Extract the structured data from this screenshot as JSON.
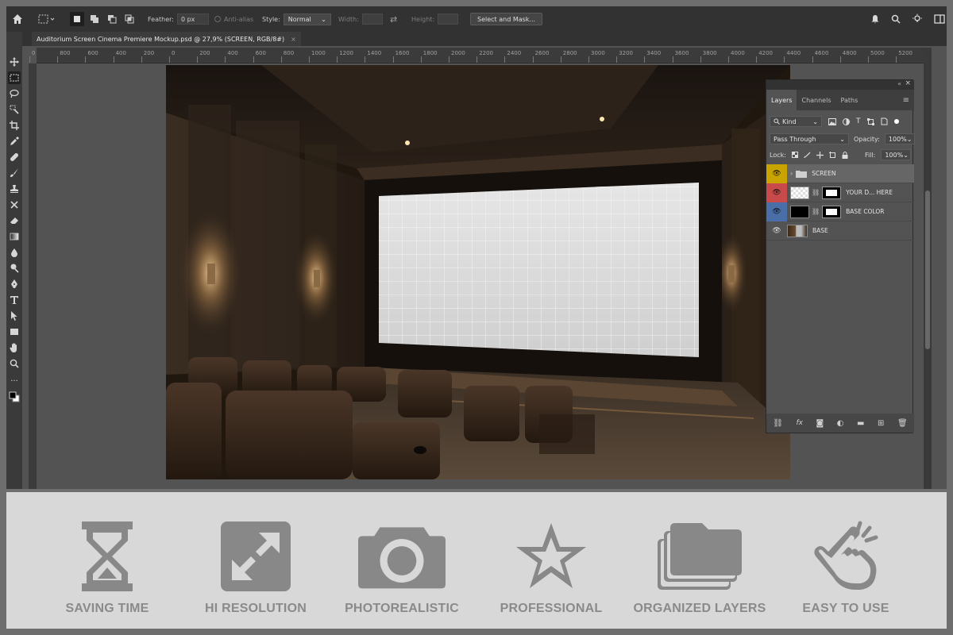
{
  "options_bar": {
    "feather_label": "Feather:",
    "feather_value": "0 px",
    "antialias_label": "Anti-alias",
    "style_label": "Style:",
    "style_value": "Normal",
    "width_label": "Width:",
    "height_label": "Height:",
    "select_mask_label": "Select and Mask..."
  },
  "document": {
    "tab_title": "Auditorium Screen Cinema Premiere Mockup.psd @ 27,9% (SCREEN, RGB/8#)",
    "close_glyph": "×"
  },
  "ruler": {
    "top_ticks": [
      "0",
      "800",
      "600",
      "400",
      "200",
      "0",
      "200",
      "400",
      "600",
      "800",
      "1000",
      "1200",
      "1400",
      "1600",
      "1800",
      "2000",
      "2200",
      "2400",
      "2600",
      "2800",
      "3000",
      "3200",
      "3400",
      "3600",
      "3800",
      "4000",
      "4200",
      "4400",
      "4600",
      "4800",
      "5000",
      "5200"
    ]
  },
  "layers_panel": {
    "tabs": [
      "Layers",
      "Channels",
      "Paths"
    ],
    "filter_kind": "Kind",
    "blend_mode": "Pass Through",
    "opacity_label": "Opacity:",
    "opacity_value": "100%",
    "lock_label": "Lock:",
    "fill_label": "Fill:",
    "fill_value": "100%",
    "layers": [
      {
        "name": "SCREEN",
        "color": "#c9a400",
        "type": "group"
      },
      {
        "name": "YOUR D... HERE",
        "color": "#c84a4a",
        "type": "smart"
      },
      {
        "name": "BASE COLOR",
        "color": "#4a6ea8",
        "type": "solid"
      },
      {
        "name": "BASE",
        "color": "",
        "type": "image"
      }
    ]
  },
  "features": [
    {
      "label": "SAVING TIME",
      "icon": "hourglass-icon"
    },
    {
      "label": "HI RESOLUTION",
      "icon": "expand-arrows-icon"
    },
    {
      "label": "PHOTOREALISTIC",
      "icon": "camera-icon"
    },
    {
      "label": "PROFESSIONAL",
      "icon": "star-icon"
    },
    {
      "label": "ORGANIZED LAYERS",
      "icon": "stacked-folders-icon"
    },
    {
      "label": "EASY TO USE",
      "icon": "tap-hand-icon"
    }
  ],
  "colors": {
    "icon_gray": "#888888",
    "banner_bg": "#d8d8d8",
    "ui_dark": "#323232"
  }
}
